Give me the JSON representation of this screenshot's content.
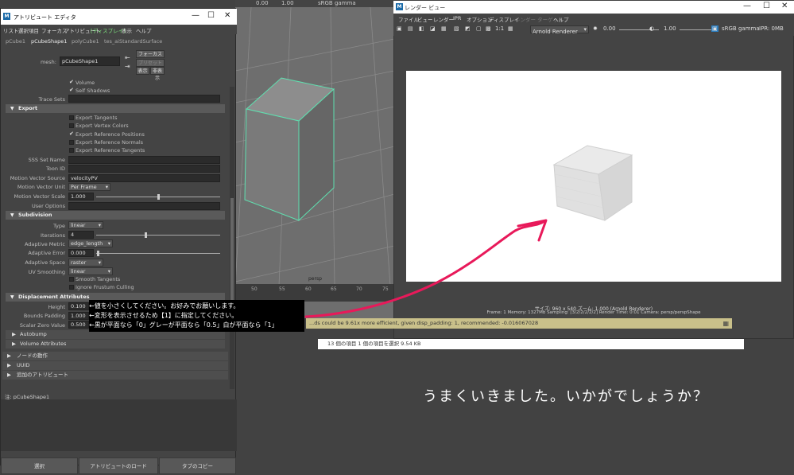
{
  "viewport": {
    "toolbar": {
      "v1": "0.00",
      "v2": "1.00",
      "colorspace": "sRGB gamma"
    },
    "camera_label": "persp",
    "timeline_ticks": [
      "50",
      "55",
      "60",
      "65",
      "70",
      "75"
    ]
  },
  "attribute_editor": {
    "title": "アトリビュート エディタ",
    "menu": [
      "リスト",
      "選択項目",
      "フォーカス",
      "アトリビュート",
      "[ディスプレイ]",
      "表示",
      "ヘルプ"
    ],
    "tabs": [
      "pCube1",
      "pCubeShape1",
      "polyCube1",
      "tes_aiStandardSurface"
    ],
    "mesh_label": "mesh:",
    "mesh_value": "pCubeShape1",
    "buttons": {
      "focus": "フォーカス",
      "preset": "プリセット",
      "show": "表示",
      "hide": "非表示"
    },
    "volume": "Volume",
    "self_shadows": "Self Shadows",
    "trace_sets": "Trace Sets",
    "export_section": "Export",
    "export_items": [
      "Export Tangents",
      "Export Vertex Colors",
      "Export Reference Positions",
      "Export Reference Normals",
      "Export Reference Tangents"
    ],
    "sss_set_name": "SSS Set Name",
    "toon_id": "Toon ID",
    "motion_vector_source": {
      "label": "Motion Vector Source",
      "value": "velocityPV"
    },
    "motion_vector_unit": {
      "label": "Motion Vector Unit",
      "value": "Per Frame"
    },
    "motion_vector_scale": {
      "label": "Motion Vector Scale",
      "value": "1.000"
    },
    "user_options": "User Options",
    "subdivision_section": "Subdivision",
    "type": {
      "label": "Type",
      "value": "linear"
    },
    "iterations": {
      "label": "Iterations",
      "value": "4"
    },
    "adaptive_metric": {
      "label": "Adaptive Metric",
      "value": "edge_length"
    },
    "adaptive_error": {
      "label": "Adaptive Error",
      "value": "0.000"
    },
    "adaptive_space": {
      "label": "Adaptive Space",
      "value": "raster"
    },
    "uv_smoothing": {
      "label": "UV Smoothing",
      "value": "linear"
    },
    "smooth_tangents": "Smooth Tangents",
    "ignore_frustum": "Ignore Frustum Culling",
    "displacement_section": "Displacement Attributes",
    "height": {
      "label": "Height",
      "value": "0.100"
    },
    "bounds_padding": {
      "label": "Bounds Padding",
      "value": "1.000"
    },
    "scalar_zero": {
      "label": "Scalar Zero Value",
      "value": "0.500"
    },
    "autobump": "Autobump",
    "volume_attributes": "Volume Attributes",
    "node_behavior": "ノードの動作",
    "uuid": "UUID",
    "extra_attributes": "追加のアトリビュート",
    "notes_label": "注: pCubeShape1",
    "bottom_buttons": [
      "選択",
      "アトリビュートのロード",
      "タブのコピー"
    ]
  },
  "render_view": {
    "title": "レンダー ビュー",
    "menu": [
      "ファイル",
      "ビュー",
      "レンダー",
      "IPR",
      "オプション",
      "ディスプレイ",
      "レンダー ターゲット",
      "ヘルプ"
    ],
    "ratio": "1:1",
    "renderer": "Arnold Renderer",
    "exposure": "0.00",
    "gamma": "1.00",
    "colorspace": "sRGB gamma",
    "ipr": "IPR: 0MB",
    "status1": "サイズ: 960 x 540  ズーム: 1.000     (Arnold Renderer)",
    "status2": "Frame: 1     Memory: 1327Mb     Sampling: [3/2/2/2/2/2]     Render Time: 0:01     Camera: persp/perspShape"
  },
  "warning": "...ds could be 9.61x more efficient, given disp_padding: 1, recommended: -0.016067028",
  "explorer_status": "13 個の項目    1 個の項目を選択  9.54 KB",
  "annotations": [
    "←値を小さくしてください。お好みでお願いします。",
    "←変形を表示させるため【1】に指定してください。",
    "←黒が平面なら「0」グレーが平面なら「0.5」白が平面なら「1」"
  ],
  "comment": "うまくいきました。いかがでしょうか？",
  "colors": {
    "accent_arrow": "#e8195a",
    "selection_wire": "#5fe0b0",
    "warning_bg": "#c9c08a"
  }
}
